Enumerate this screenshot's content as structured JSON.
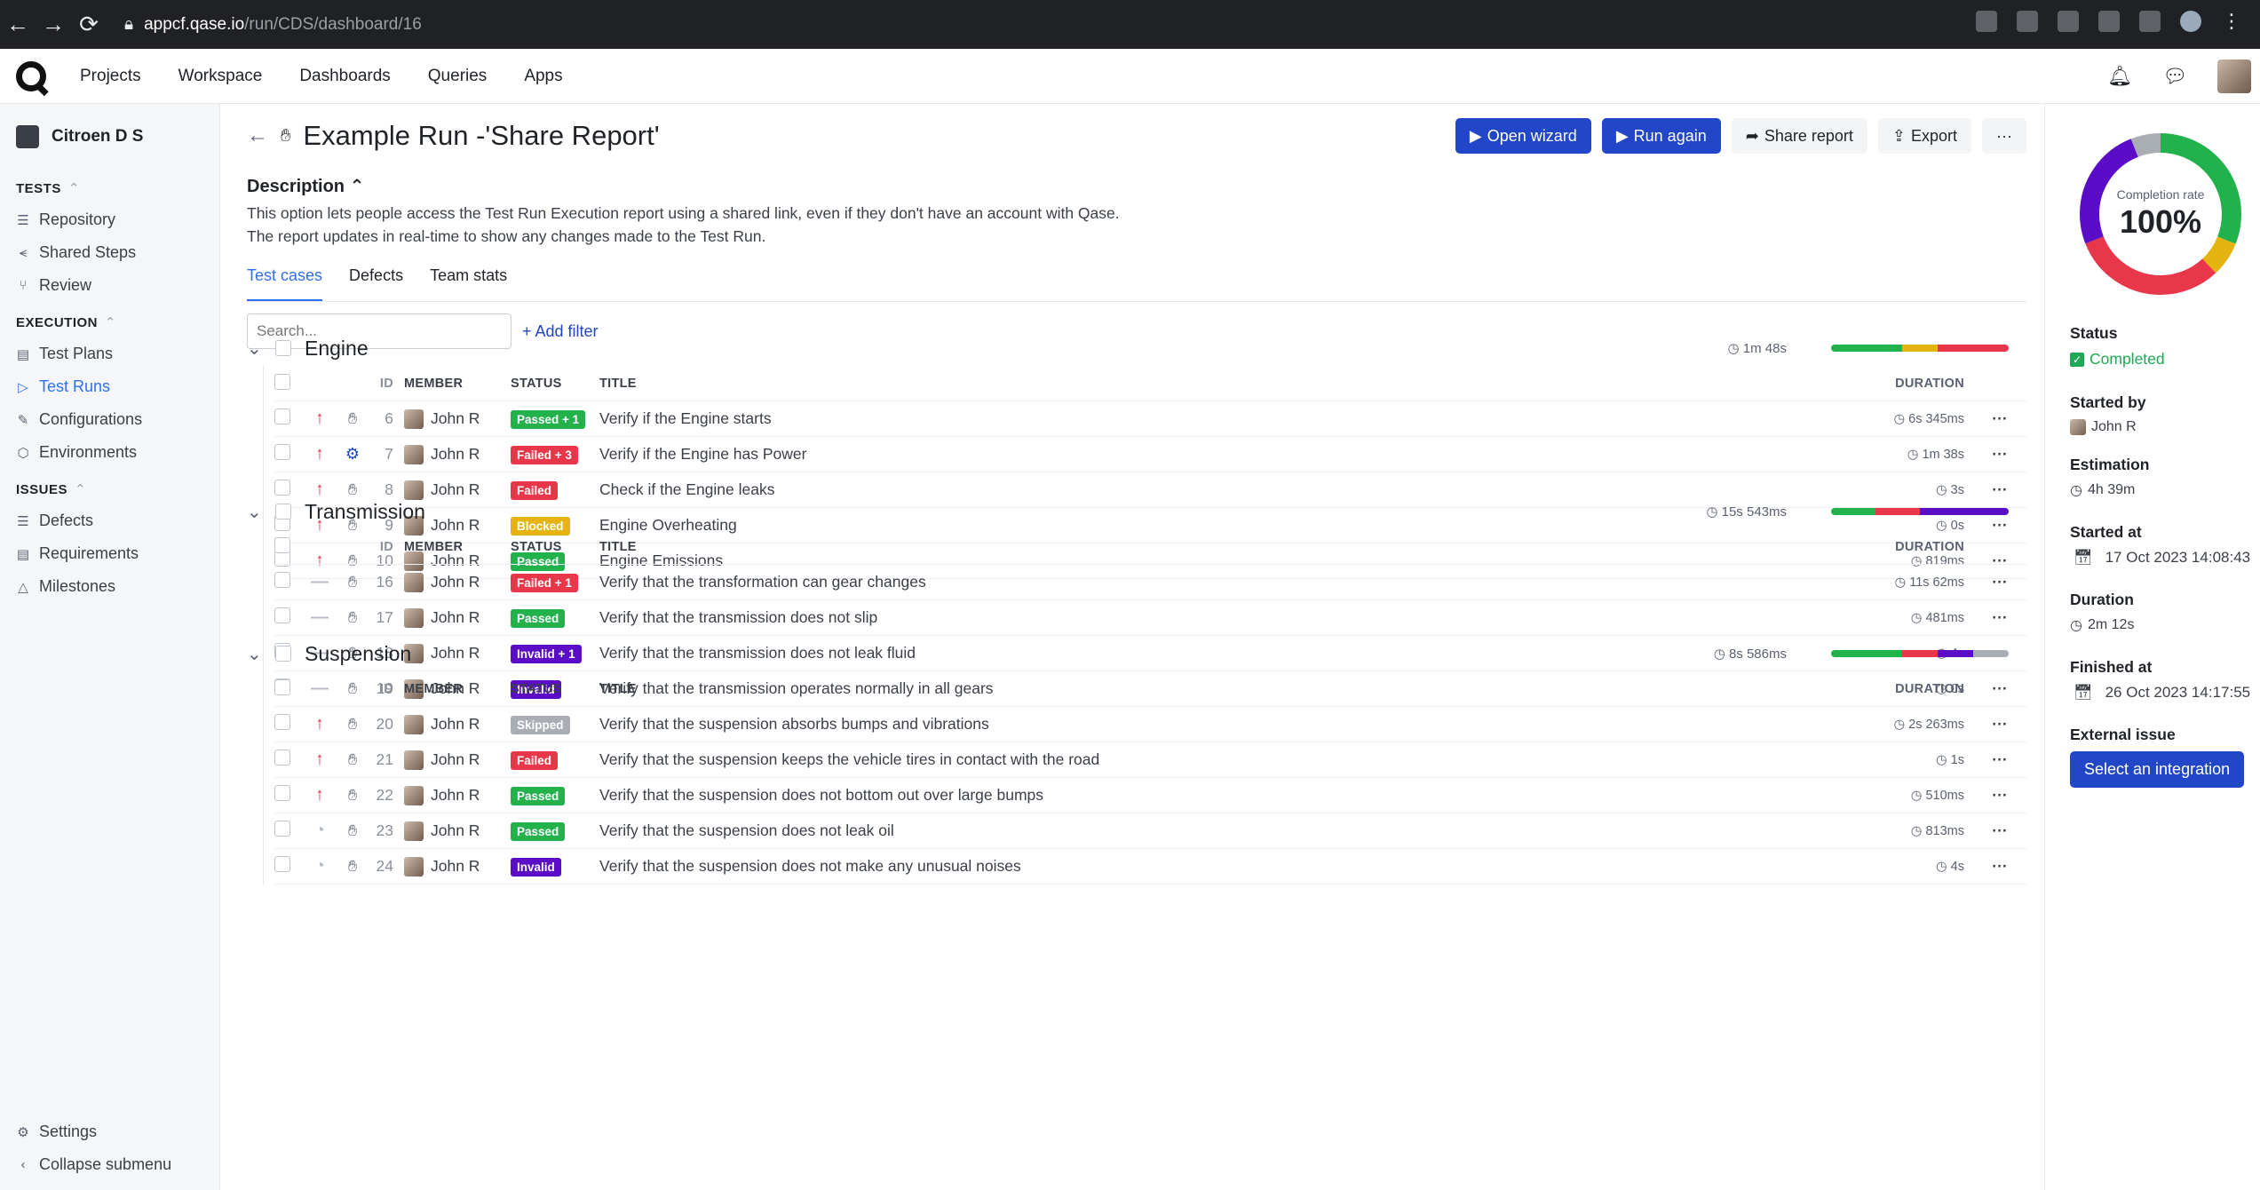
{
  "browser": {
    "url_host": "appcf.qase.io",
    "url_path": "/run/CDS/dashboard/16"
  },
  "topnav": {
    "items": [
      "Projects",
      "Workspace",
      "Dashboards",
      "Queries",
      "Apps"
    ]
  },
  "sidebar": {
    "project": "Citroen D S",
    "sections": [
      {
        "title": "TESTS",
        "items": [
          "Repository",
          "Shared Steps",
          "Review"
        ]
      },
      {
        "title": "EXECUTION",
        "items": [
          "Test Plans",
          "Test Runs",
          "Configurations",
          "Environments"
        ]
      },
      {
        "title": "ISSUES",
        "items": [
          "Defects",
          "Requirements",
          "Milestones"
        ]
      }
    ],
    "bottom": [
      "Settings",
      "Collapse submenu"
    ]
  },
  "run": {
    "title": "Example Run -'Share Report'",
    "actions": {
      "open_wizard": "Open wizard",
      "run_again": "Run again",
      "share_report": "Share report",
      "export": "Export",
      "more": "···"
    },
    "description_header": "Description",
    "description_l1": "This option lets people access the Test Run Execution report using a shared link, even if they don't have an account with Qase.",
    "description_l2": "The report updates in real-time to show any changes made to the Test Run.",
    "tabs": [
      "Test cases",
      "Defects",
      "Team stats"
    ],
    "search_placeholder": "Search...",
    "add_filter": "+ Add filter"
  },
  "columns": {
    "id": "ID",
    "member": "MEMBER",
    "status": "STATUS",
    "title": "TITLE",
    "duration": "DURATION"
  },
  "colors": {
    "passed": "#21b24b",
    "failed": "#e8364a",
    "blocked": "#e6b410",
    "invalid": "#5b0cc6",
    "skipped": "#a9aeb5"
  },
  "suites": [
    {
      "name": "Engine",
      "duration": "1m 48s",
      "bar": [
        {
          "color": "passed",
          "pct": 40
        },
        {
          "color": "blocked",
          "pct": 20
        },
        {
          "color": "failed",
          "pct": 40
        }
      ],
      "rows": [
        {
          "id": "6",
          "member": "John R",
          "status": "Passed + 1",
          "status_color": "passed",
          "title": "Verify if the Engine starts",
          "duration": "6s 345ms",
          "priority": "high",
          "automation": "manual"
        },
        {
          "id": "7",
          "member": "John R",
          "status": "Failed + 3",
          "status_color": "failed",
          "title": "Verify if the Engine has Power",
          "duration": "1m 38s",
          "priority": "high",
          "automation": "auto"
        },
        {
          "id": "8",
          "member": "John R",
          "status": "Failed",
          "status_color": "failed",
          "title": "Check if the Engine leaks",
          "duration": "3s",
          "priority": "high",
          "automation": "manual"
        },
        {
          "id": "9",
          "member": "John R",
          "status": "Blocked",
          "status_color": "blocked",
          "title": "Engine Overheating",
          "duration": "0s",
          "priority": "high",
          "automation": "manual"
        },
        {
          "id": "10",
          "member": "John R",
          "status": "Passed",
          "status_color": "passed",
          "title": "Engine Emissions",
          "duration": "819ms",
          "priority": "high",
          "automation": "manual"
        }
      ]
    },
    {
      "name": "Transmission",
      "duration": "15s 543ms",
      "bar": [
        {
          "color": "passed",
          "pct": 25
        },
        {
          "color": "failed",
          "pct": 25
        },
        {
          "color": "invalid",
          "pct": 50
        }
      ],
      "rows": [
        {
          "id": "16",
          "member": "John R",
          "status": "Failed + 1",
          "status_color": "failed",
          "title": "Verify that the transformation can gear changes",
          "duration": "11s 62ms",
          "priority": "none",
          "automation": "manual"
        },
        {
          "id": "17",
          "member": "John R",
          "status": "Passed",
          "status_color": "passed",
          "title": "Verify that the transmission does not slip",
          "duration": "481ms",
          "priority": "none",
          "automation": "manual"
        },
        {
          "id": "18",
          "member": "John R",
          "status": "Invalid + 1",
          "status_color": "invalid",
          "title": "Verify that the transmission does not leak fluid",
          "duration": "4s",
          "priority": "none",
          "automation": "manual"
        },
        {
          "id": "19",
          "member": "John R",
          "status": "Invalid",
          "status_color": "invalid",
          "title": "Verify that the transmission operates normally in all gears",
          "duration": "0s",
          "priority": "none",
          "automation": "manual"
        }
      ]
    },
    {
      "name": "Suspension",
      "duration": "8s 586ms",
      "bar": [
        {
          "color": "passed",
          "pct": 40
        },
        {
          "color": "failed",
          "pct": 20
        },
        {
          "color": "invalid",
          "pct": 20
        },
        {
          "color": "skipped",
          "pct": 20
        }
      ],
      "rows": [
        {
          "id": "20",
          "member": "John R",
          "status": "Skipped",
          "status_color": "skipped",
          "title": "Verify that the suspension absorbs bumps and vibrations",
          "duration": "2s 263ms",
          "priority": "high",
          "automation": "manual"
        },
        {
          "id": "21",
          "member": "John R",
          "status": "Failed",
          "status_color": "failed",
          "title": "Verify that the suspension keeps the vehicle tires in contact with the road",
          "duration": "1s",
          "priority": "high",
          "automation": "manual"
        },
        {
          "id": "22",
          "member": "John R",
          "status": "Passed",
          "status_color": "passed",
          "title": "Verify that the suspension does not bottom out over large bumps",
          "duration": "510ms",
          "priority": "high",
          "automation": "manual"
        },
        {
          "id": "23",
          "member": "John R",
          "status": "Passed",
          "status_color": "passed",
          "title": "Verify that the suspension does not leak oil",
          "duration": "813ms",
          "priority": "undefined",
          "automation": "manual"
        },
        {
          "id": "24",
          "member": "John R",
          "status": "Invalid",
          "status_color": "invalid",
          "title": "Verify that the suspension does not make any unusual noises",
          "duration": "4s",
          "priority": "undefined",
          "automation": "manual"
        }
      ]
    }
  ],
  "summary": {
    "completion_label": "Completion rate",
    "completion_value": "100%",
    "donut": [
      {
        "color": "passed",
        "pct": 31
      },
      {
        "color": "blocked",
        "pct": 7
      },
      {
        "color": "failed",
        "pct": 31
      },
      {
        "color": "invalid",
        "pct": 25
      },
      {
        "color": "skipped",
        "pct": 6
      }
    ],
    "status_label": "Status",
    "status_value": "Completed",
    "started_by_label": "Started by",
    "started_by_value": "John R",
    "estimation_label": "Estimation",
    "estimation_value": "4h 39m",
    "started_at_label": "Started at",
    "started_at_value": "17 Oct 2023 14:08:43",
    "duration_label": "Duration",
    "duration_value": "2m 12s",
    "finished_at_label": "Finished at",
    "finished_at_value": "26 Oct 2023 14:17:55",
    "external_issue_label": "External issue",
    "external_issue_button": "Select an integration"
  }
}
